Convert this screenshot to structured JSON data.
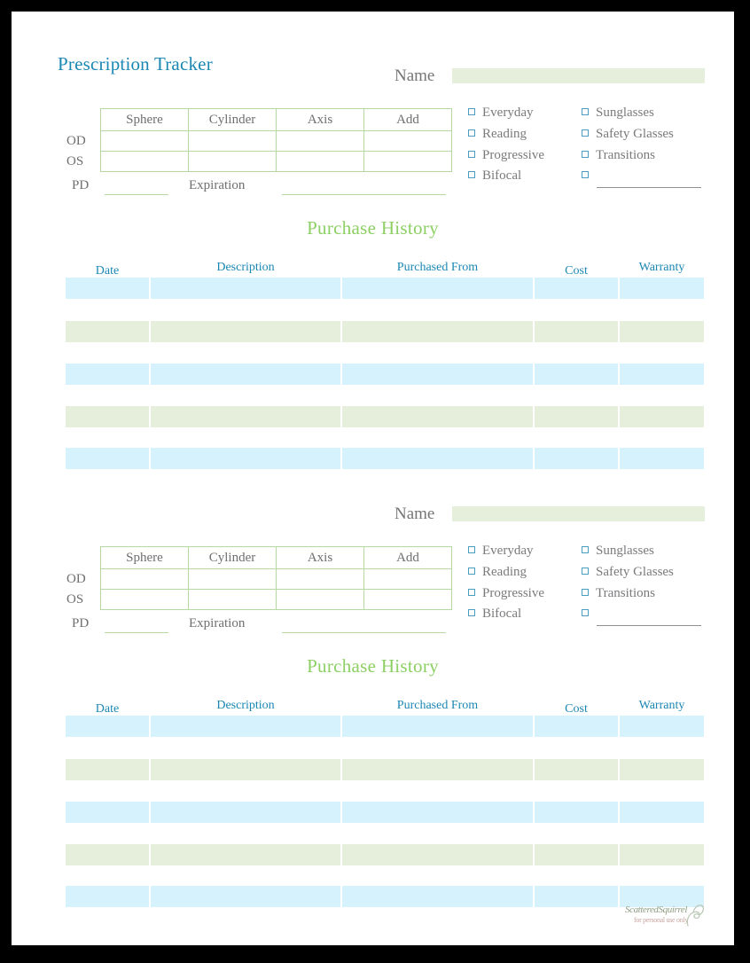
{
  "page": {
    "title": "Prescription Tracker",
    "footer": {
      "brand": "ScatteredSquirrel",
      "tagline": "for personal use only",
      "icon": "squirrel-icon"
    },
    "colors": {
      "title_teal": "#1b87b3",
      "heading_green": "#8ccf63",
      "row_blue": "#d6f2fc",
      "row_green": "#e5efdc",
      "border_green": "#b6d9a3",
      "checkbox_blue": "#4a9dbe",
      "label_gray": "#7a7a7d",
      "page_background": "#ffffff",
      "canvas_background": "#000000"
    }
  },
  "sections": [
    {
      "name_label": "Name",
      "name_value": "",
      "rx": {
        "columns": [
          "Sphere",
          "Cylinder",
          "Axis",
          "Add"
        ],
        "rows": [
          {
            "label": "OD",
            "values": [
              "",
              "",
              "",
              ""
            ]
          },
          {
            "label": "OS",
            "values": [
              "",
              "",
              "",
              ""
            ]
          }
        ],
        "pd_label": "PD",
        "pd_value": "",
        "expiration_label": "Expiration",
        "expiration_value": ""
      },
      "checkboxes": {
        "left": [
          "Everyday",
          "Reading",
          "Progressive",
          "Bifocal"
        ],
        "right": [
          "Sunglasses",
          "Safety Glasses",
          "Transitions",
          ""
        ]
      },
      "purchase_history": {
        "heading": "Purchase History",
        "columns": [
          "Date",
          "Description",
          "Purchased From",
          "Cost",
          "Warranty"
        ],
        "rows": [
          [
            "",
            "",
            "",
            "",
            ""
          ],
          [
            "",
            "",
            "",
            "",
            ""
          ],
          [
            "",
            "",
            "",
            "",
            ""
          ],
          [
            "",
            "",
            "",
            "",
            ""
          ],
          [
            "",
            "",
            "",
            "",
            ""
          ]
        ]
      }
    },
    {
      "name_label": "Name",
      "name_value": "",
      "rx": {
        "columns": [
          "Sphere",
          "Cylinder",
          "Axis",
          "Add"
        ],
        "rows": [
          {
            "label": "OD",
            "values": [
              "",
              "",
              "",
              ""
            ]
          },
          {
            "label": "OS",
            "values": [
              "",
              "",
              "",
              ""
            ]
          }
        ],
        "pd_label": "PD",
        "pd_value": "",
        "expiration_label": "Expiration",
        "expiration_value": ""
      },
      "checkboxes": {
        "left": [
          "Everyday",
          "Reading",
          "Progressive",
          "Bifocal"
        ],
        "right": [
          "Sunglasses",
          "Safety Glasses",
          "Transitions",
          ""
        ]
      },
      "purchase_history": {
        "heading": "Purchase History",
        "columns": [
          "Date",
          "Description",
          "Purchased From",
          "Cost",
          "Warranty"
        ],
        "rows": [
          [
            "",
            "",
            "",
            "",
            ""
          ],
          [
            "",
            "",
            "",
            "",
            ""
          ],
          [
            "",
            "",
            "",
            "",
            ""
          ],
          [
            "",
            "",
            "",
            "",
            ""
          ],
          [
            "",
            "",
            "",
            "",
            ""
          ]
        ]
      }
    }
  ]
}
